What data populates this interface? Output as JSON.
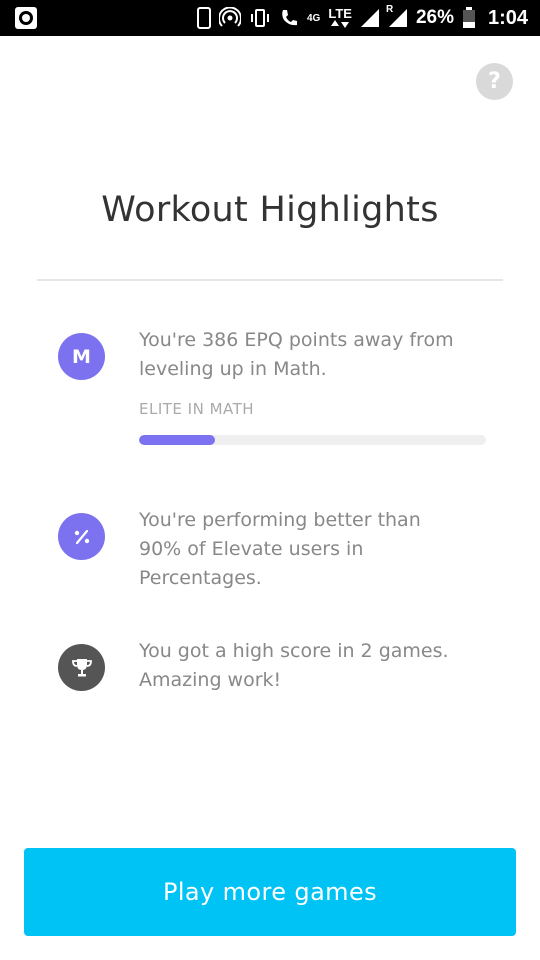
{
  "status_bar": {
    "network_4g": "4G",
    "network_lte": "LTE",
    "roaming": "R",
    "battery": "26%",
    "time": "1:04"
  },
  "help": {
    "label": "?"
  },
  "title": "Workout Highlights",
  "highlights": [
    {
      "icon_letter": "M",
      "icon_color": "#7c72f0",
      "text": "You're 386 EPQ points away from leveling up in Math.",
      "sub_label": "ELITE IN MATH",
      "progress": 0.22
    },
    {
      "icon_name": "percent-icon",
      "icon_color": "#7c72f0",
      "text": "You're performing better than 90% of Elevate users in Percentages."
    },
    {
      "icon_name": "trophy-icon",
      "icon_color": "#555555",
      "text": "You got a high score in 2 games. Amazing work!"
    }
  ],
  "cta": {
    "label": "Play more games",
    "color": "#00c3f5"
  }
}
